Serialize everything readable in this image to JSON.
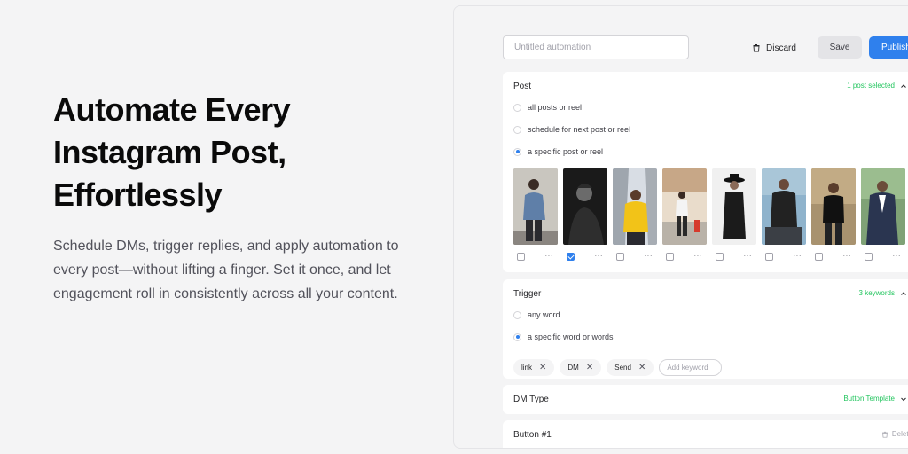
{
  "hero": {
    "title_line1": "Automate Every",
    "title_line2": "Instagram Post,",
    "title_line3": "Effortlessly",
    "description": "Schedule DMs, trigger replies, and apply automation to every post—without lifting a finger. Set it once, and let engagement roll in consistently across all your content."
  },
  "toolbar": {
    "name_placeholder": "Untitled automation",
    "discard_label": "Discard",
    "save_label": "Save",
    "publish_label": "Publish"
  },
  "post_section": {
    "title": "Post",
    "meta": "1 post selected",
    "options": [
      {
        "label": "all posts or reel",
        "selected": false
      },
      {
        "label": "schedule for next post or reel",
        "selected": false
      },
      {
        "label": "a specific post or reel",
        "selected": true
      }
    ],
    "thumbnails": [
      {
        "checked": false,
        "more": "···"
      },
      {
        "checked": true,
        "more": "···"
      },
      {
        "checked": false,
        "more": "···"
      },
      {
        "checked": false,
        "more": "···"
      },
      {
        "checked": false,
        "more": "···"
      },
      {
        "checked": false,
        "more": "···"
      },
      {
        "checked": false,
        "more": "···"
      },
      {
        "checked": false,
        "more": "···"
      }
    ]
  },
  "trigger_section": {
    "title": "Trigger",
    "meta": "3 keywords",
    "options": [
      {
        "label": "any word",
        "selected": false
      },
      {
        "label": "a specific word or words",
        "selected": true
      }
    ],
    "keywords": [
      "link",
      "DM",
      "Send"
    ],
    "keyword_placeholder": "Add keyword",
    "remove_glyph": "✕"
  },
  "dm_type_section": {
    "title": "DM Type",
    "meta": "Button Template"
  },
  "button_section": {
    "title": "Button #1",
    "delete_label": "Delete"
  },
  "colors": {
    "accent": "#2f80ed",
    "success": "#22c55e"
  }
}
